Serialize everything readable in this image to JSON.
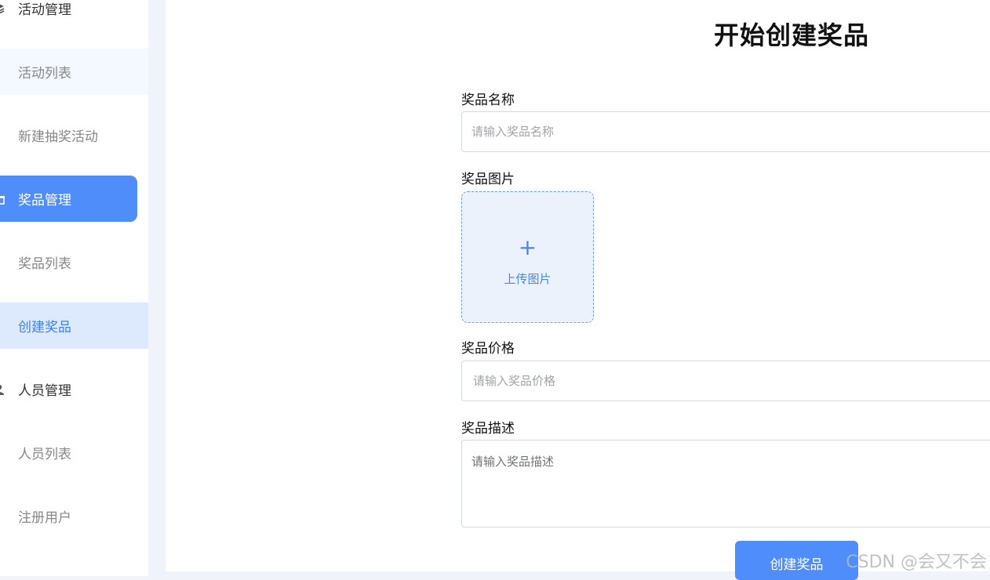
{
  "sidebar": {
    "groups": [
      {
        "label": "活动管理",
        "icon": "layers-icon"
      },
      {
        "label": "奖品管理",
        "icon": "gift-icon"
      },
      {
        "label": "人员管理",
        "icon": "user-icon"
      }
    ],
    "items": [
      {
        "label": "活动列表"
      },
      {
        "label": "新建抽奖活动"
      },
      {
        "label": "奖品列表"
      },
      {
        "label": "创建奖品"
      },
      {
        "label": "人员列表"
      },
      {
        "label": "注册用户"
      }
    ]
  },
  "main": {
    "title": "开始创建奖品",
    "form": {
      "name_label": "奖品名称",
      "name_placeholder": "请输入奖品名称",
      "image_label": "奖品图片",
      "upload_plus": "+",
      "upload_text": "上传图片",
      "price_label": "奖品价格",
      "price_placeholder": "请输入奖品价格",
      "desc_label": "奖品描述",
      "desc_placeholder": "请输入奖品描述",
      "submit_label": "创建奖品"
    }
  },
  "watermark": "CSDN @会又不会",
  "colors": {
    "accent": "#4e8dfa",
    "selected_bg": "#dde9fd",
    "upload_bg": "#ecf2fc"
  }
}
